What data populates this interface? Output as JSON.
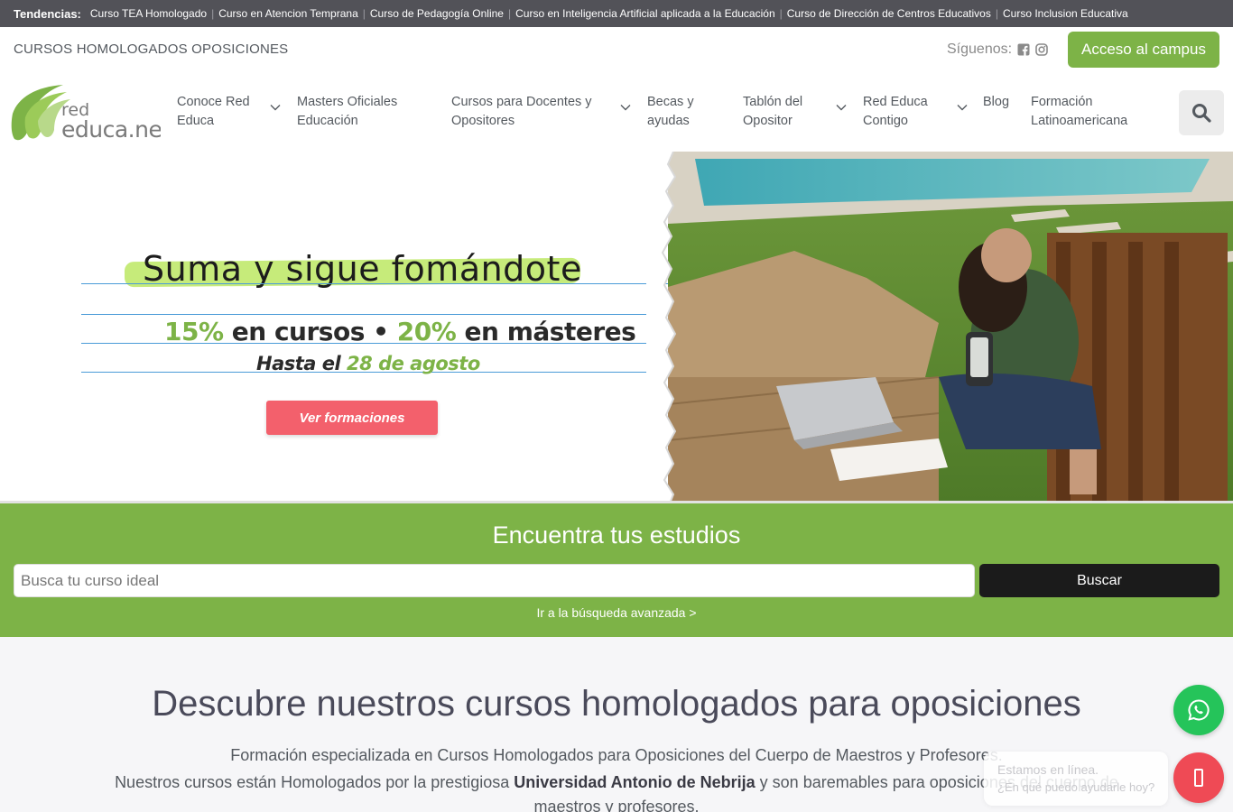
{
  "trends": {
    "title": "Tendencias:",
    "items": [
      "Curso TEA Homologado",
      "Curso en Atencion Temprana",
      "Curso de Pedagogía Online",
      "Curso en Inteligencia Artificial aplicada a la Educación",
      "Curso de Dirección de Centros Educativos",
      "Curso Inclusion Educativa"
    ]
  },
  "header": {
    "site_tag": "CURSOS HOMOLOGADOS OPOSICIONES",
    "follow_label": "Síguenos:",
    "campus_button": "Acceso al campus",
    "social_icons": [
      "facebook-icon",
      "instagram-icon"
    ]
  },
  "logo": {
    "line1": "red",
    "line2": "educa.net"
  },
  "nav": {
    "items": [
      {
        "line1": "Conoce Red",
        "line2": "Educa",
        "has_dropdown": true
      },
      {
        "line1": "Masters Oficiales",
        "line2": "Educación",
        "has_dropdown": false
      },
      {
        "line1": "Cursos para Docentes y",
        "line2": "Opositores",
        "has_dropdown": true
      },
      {
        "line1": "Becas y",
        "line2": "ayudas",
        "has_dropdown": false
      },
      {
        "line1": "Tablón del",
        "line2": "Opositor",
        "has_dropdown": true
      },
      {
        "line1": "Red Educa",
        "line2": "Contigo",
        "has_dropdown": true
      },
      {
        "line1": "Blog",
        "line2": "",
        "has_dropdown": false
      },
      {
        "line1": "Formación",
        "line2": "Latinoamericana",
        "has_dropdown": false
      }
    ]
  },
  "banner": {
    "headline": "Suma y sigue fomándote",
    "offer_pct1": "15%",
    "offer_text1": " en cursos • ",
    "offer_pct2": "20%",
    "offer_text2": " en másteres",
    "deadline_prefix": "Hasta el ",
    "deadline_date": "28 de agosto",
    "cta": "Ver formaciones"
  },
  "search": {
    "title": "Encuentra tus estudios",
    "placeholder": "Busca tu curso ideal",
    "button": "Buscar",
    "advanced_link": "Ir a la búsqueda avanzada >"
  },
  "discover": {
    "heading": "Descubre nuestros cursos homologados para oposiciones",
    "line1": "Formación especializada en Cursos Homologados para Oposiciones del Cuerpo de Maestros y Profesores.",
    "line2_pre": "Nuestros cursos están Homologados por la prestigiosa ",
    "line2_bold": "Universidad Antonio de Nebrija",
    "line2_post": " y son baremables para oposiciones del cuerpo de maestros y profesores."
  },
  "chat": {
    "status": "Estamos en línea.",
    "prompt": "¿En qué puedo ayudarle hoy?"
  },
  "colors": {
    "brand_green": "#7db347",
    "trend_bar": "#525258",
    "cta_red": "#f3606c",
    "whatsapp": "#25c45a"
  }
}
